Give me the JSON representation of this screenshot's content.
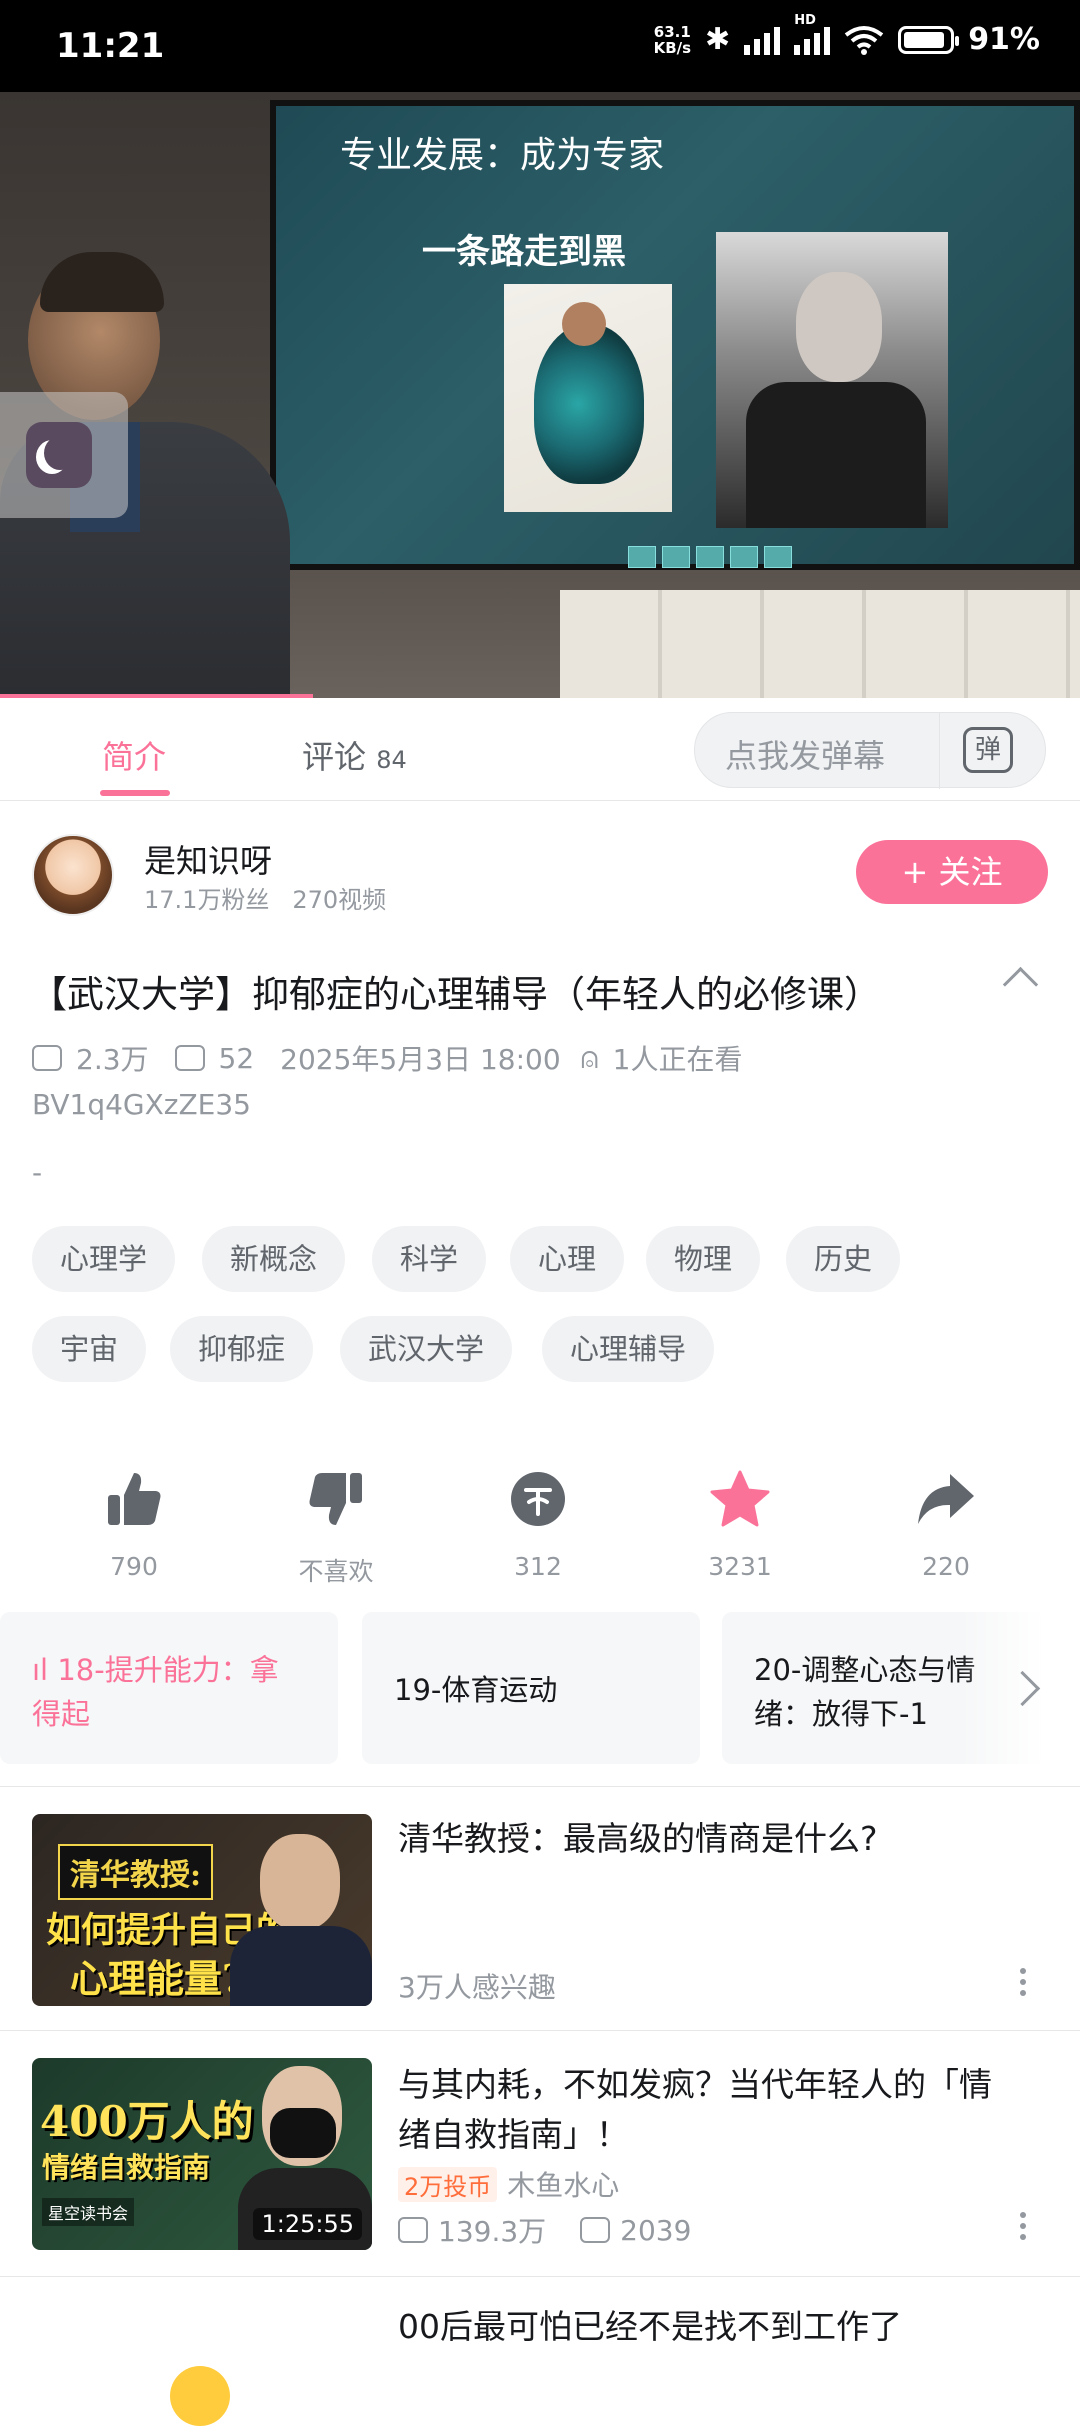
{
  "status_bar": {
    "time": "11:21",
    "net_speed_value": "63.1",
    "net_speed_unit": "KB/s",
    "network_label": "HD",
    "battery": "91%"
  },
  "video": {
    "slide_title": "专业发展：成为专家",
    "slide_subtitle": "一条路走到黑",
    "progress_fraction": 0.29
  },
  "tabs": {
    "intro": "简介",
    "comments": "评论",
    "comments_count": "84",
    "danmaku_placeholder": "点我发弹幕",
    "danmaku_icon_glyph": "弹"
  },
  "uploader": {
    "name": "是知识呀",
    "followers": "17.1万粉丝",
    "videos": "270视频",
    "follow_label": "+ 关注"
  },
  "video_info": {
    "title": "【武汉大学】抑郁症的心理辅导（年轻人的必修课）",
    "views": "2.3万",
    "danmaku": "52",
    "date": "2025年5月3日 18:00",
    "watching": "1人正在看",
    "bvid": "BV1q4GXzZE35",
    "description": "-"
  },
  "tags": [
    "心理学",
    "新概念",
    "科学",
    "心理",
    "物理",
    "历史",
    "宇宙",
    "抑郁症",
    "武汉大学",
    "心理辅导"
  ],
  "actions": [
    {
      "icon": "thumbs-up-icon",
      "label": "790"
    },
    {
      "icon": "thumbs-down-icon",
      "label": "不喜欢"
    },
    {
      "icon": "coin-icon",
      "label": "312"
    },
    {
      "icon": "star-icon",
      "label": "3231"
    },
    {
      "icon": "share-icon",
      "label": "220"
    }
  ],
  "playlist": [
    {
      "label": "18-提升能力：拿得起",
      "line1": "ıl 18-提升能力：拿",
      "line2": "得起",
      "active": true
    },
    {
      "label": "19-体育运动",
      "line1": "19-体育运动",
      "line2": ""
    },
    {
      "label": "20-调整心态与情绪：放得下-1",
      "line1": "20-调整心态与情",
      "line2": "绪：放得下-1"
    }
  ],
  "recommendations": [
    {
      "title": "清华教授：最高级的情商是什么?",
      "thumb_text_1": "清华教授:",
      "thumb_text_2": "如何提升自己的",
      "thumb_text_3": "心理能量?",
      "interest": "3万人感兴趣"
    },
    {
      "title_line1": "与其内耗，不如发疯？当代年轻人的「情",
      "title_line2": "绪自救指南」！",
      "badge": "2万投币",
      "author": "木鱼水心",
      "views": "139.3万",
      "danmaku": "2039",
      "duration": "1:25:55",
      "thumb_text_1": "400万人的",
      "thumb_text_2": "情绪自救指南",
      "thumb_brand": "星空读书会"
    },
    {
      "title": "00后最可怕已经不是找不到工作了"
    }
  ],
  "colors": {
    "accent": "#fb7299",
    "text_primary": "#18191c",
    "text_secondary": "#9499a0"
  }
}
